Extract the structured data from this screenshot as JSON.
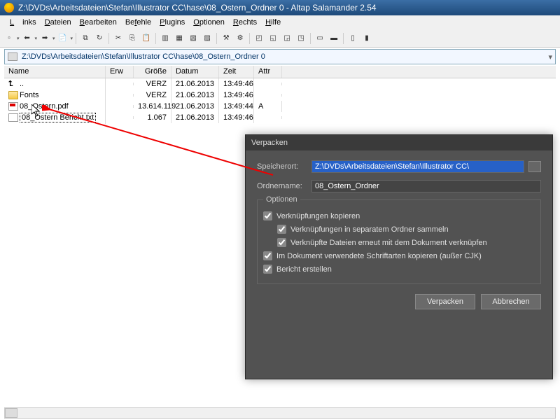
{
  "window": {
    "title": "Z:\\DVDs\\Arbeitsdateien\\Stefan\\Illustrator CC\\hase\\08_Ostern_Ordner 0 - Altap Salamander 2.54"
  },
  "menu": [
    "Links",
    "Dateien",
    "Bearbeiten",
    "Befehle",
    "Plugins",
    "Optionen",
    "Rechts",
    "Hilfe"
  ],
  "path": "Z:\\DVDs\\Arbeitsdateien\\Stefan\\Illustrator CC\\hase\\08_Ostern_Ordner 0",
  "columns": {
    "name": "Name",
    "erw": "Erw",
    "groesse": "Größe",
    "datum": "Datum",
    "zeit": "Zeit",
    "attr": "Attr"
  },
  "files": [
    {
      "name": "..",
      "erw": "",
      "size": "VERZ",
      "date": "21.06.2013",
      "time": "13:49:46",
      "attr": "",
      "kind": "up"
    },
    {
      "name": "Fonts",
      "erw": "",
      "size": "VERZ",
      "date": "21.06.2013",
      "time": "13:49:46",
      "attr": "",
      "kind": "folder"
    },
    {
      "name": "08_Ostern.pdf",
      "erw": "",
      "size": "13.614.119",
      "date": "21.06.2013",
      "time": "13:49:44",
      "attr": "A",
      "kind": "pdf"
    },
    {
      "name": "08_Ostern Bericht.txt",
      "erw": "",
      "size": "1.067",
      "date": "21.06.2013",
      "time": "13:49:46",
      "attr": "",
      "kind": "txt",
      "selected": true
    }
  ],
  "dialog": {
    "title": "Verpacken",
    "loc_label": "Speicherort:",
    "loc_value": "Z:\\DVDs\\Arbeitsdateien\\Stefan\\Illustrator CC\\",
    "name_label": "Ordnername:",
    "name_value": "08_Ostern_Ordner",
    "options_title": "Optionen",
    "opts": {
      "copy_links": "Verknüpfungen kopieren",
      "sep_folder": "Verknüpfungen in separatem Ordner sammeln",
      "relink": "Verknüpfte Dateien erneut mit dem Dokument verknüpfen",
      "fonts": "Im Dokument verwendete Schriftarten kopieren (außer CJK)",
      "report": "Bericht erstellen"
    },
    "btn_pack": "Verpacken",
    "btn_cancel": "Abbrechen"
  }
}
